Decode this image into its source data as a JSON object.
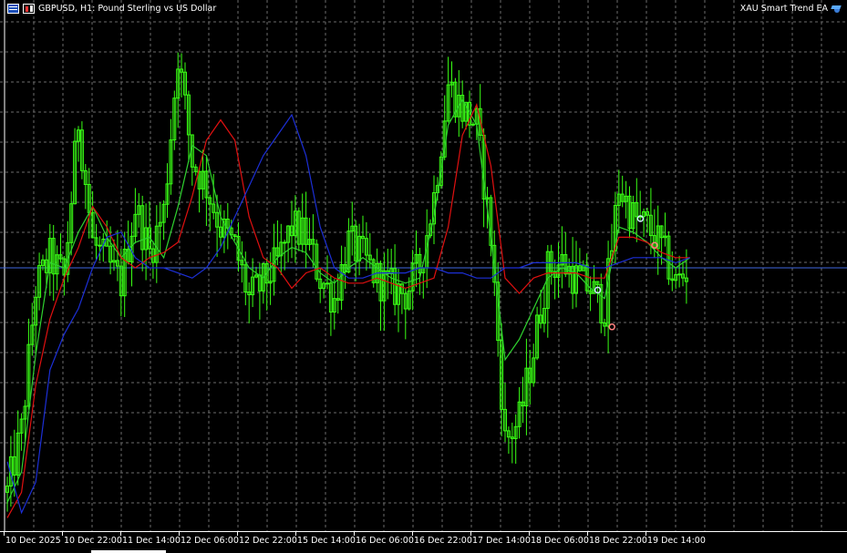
{
  "header": {
    "symbol_label": "GBPUSD, H1:  Pound Sterling vs US Dollar",
    "expert_label": "XAU Smart Trend EA"
  },
  "icons": [
    "list-icon",
    "candle-chart-icon",
    "graduation-cap-icon"
  ],
  "colors": {
    "background": "#000000",
    "grid": "#6b6b6b",
    "candles": "#39ff14",
    "ma_fast": "#2fd22f",
    "ma_medium": "#e01010",
    "ma_slow": "#1c2fd6",
    "price_line": "#4169e1",
    "buy_marker": "#cfe6ff",
    "sell_marker": "#ff8080"
  },
  "time_axis": {
    "labels": [
      "10 Dec 2025",
      "10 Dec 22:00",
      "11 Dec 14:00",
      "12 Dec 06:00",
      "12 Dec 22:00",
      "15 Dec 14:00",
      "16 Dec 06:00",
      "16 Dec 22:00",
      "17 Dec 14:00",
      "18 Dec 06:00",
      "18 Dec 22:00",
      "19 Dec 14:00"
    ]
  },
  "chart_data": {
    "type": "candlestick",
    "symbol": "GBPUSD",
    "timeframe": "H1",
    "grid": true,
    "price_axis_visible": false,
    "x_categories": [
      "10 Dec 2025",
      "10 Dec 22:00",
      "11 Dec 14:00",
      "12 Dec 06:00",
      "12 Dec 22:00",
      "15 Dec 14:00",
      "16 Dec 06:00",
      "16 Dec 22:00",
      "17 Dec 14:00",
      "18 Dec 06:00",
      "18 Dec 22:00",
      "19 Dec 14:00"
    ],
    "close_relative": [
      0.06,
      0.18,
      0.46,
      0.52,
      0.48,
      0.79,
      0.55,
      0.51,
      0.47,
      0.62,
      0.53,
      0.61,
      0.92,
      0.71,
      0.66,
      0.58,
      0.54,
      0.44,
      0.47,
      0.51,
      0.58,
      0.56,
      0.48,
      0.44,
      0.55,
      0.52,
      0.48,
      0.46,
      0.45,
      0.5,
      0.64,
      0.86,
      0.81,
      0.78,
      0.56,
      0.16,
      0.2,
      0.34,
      0.5,
      0.51,
      0.48,
      0.46,
      0.42,
      0.66,
      0.6,
      0.58,
      0.54,
      0.47,
      0.5
    ],
    "series": [
      {
        "role": "fast moving average",
        "values": [
          0.04,
          0.1,
          0.33,
          0.51,
          0.5,
          0.57,
          0.62,
          0.56,
          0.52,
          0.55,
          0.56,
          0.52,
          0.62,
          0.74,
          0.72,
          0.6,
          0.55,
          0.5,
          0.48,
          0.52,
          0.54,
          0.53,
          0.49,
          0.47,
          0.5,
          0.52,
          0.5,
          0.48,
          0.47,
          0.48,
          0.6,
          0.78,
          0.83,
          0.78,
          0.56,
          0.32,
          0.36,
          0.42,
          0.48,
          0.5,
          0.49,
          0.46,
          0.44,
          0.58,
          0.57,
          0.55,
          0.52,
          0.5,
          0.52
        ]
      },
      {
        "role": "medium moving average",
        "values": [
          0.01,
          0.06,
          0.27,
          0.4,
          0.48,
          0.54,
          0.62,
          0.58,
          0.52,
          0.5,
          0.52,
          0.53,
          0.55,
          0.64,
          0.75,
          0.79,
          0.75,
          0.6,
          0.52,
          0.5,
          0.46,
          0.49,
          0.5,
          0.48,
          0.47,
          0.47,
          0.48,
          0.47,
          0.46,
          0.47,
          0.48,
          0.58,
          0.76,
          0.82,
          0.7,
          0.48,
          0.45,
          0.48,
          0.49,
          0.49,
          0.49,
          0.48,
          0.48,
          0.56,
          0.56,
          0.55,
          0.53,
          0.52,
          0.52
        ]
      },
      {
        "role": "slow moving average",
        "values": [
          0.12,
          0.02,
          0.08,
          0.3,
          0.37,
          0.42,
          0.5,
          0.56,
          0.57,
          0.52,
          0.5,
          0.5,
          0.49,
          0.48,
          0.5,
          0.54,
          0.6,
          0.66,
          0.72,
          0.76,
          0.8,
          0.72,
          0.58,
          0.5,
          0.48,
          0.48,
          0.49,
          0.49,
          0.49,
          0.5,
          0.5,
          0.49,
          0.49,
          0.48,
          0.48,
          0.5,
          0.5,
          0.51,
          0.51,
          0.51,
          0.51,
          0.5,
          0.5,
          0.51,
          0.52,
          0.52,
          0.52,
          0.51,
          0.52
        ]
      }
    ],
    "price_line_relative": 0.5,
    "trade_markers": [
      {
        "type": "buy",
        "index": 41
      },
      {
        "type": "sell",
        "index": 42
      },
      {
        "type": "buy",
        "index": 44
      },
      {
        "type": "sell",
        "index": 45
      }
    ]
  }
}
